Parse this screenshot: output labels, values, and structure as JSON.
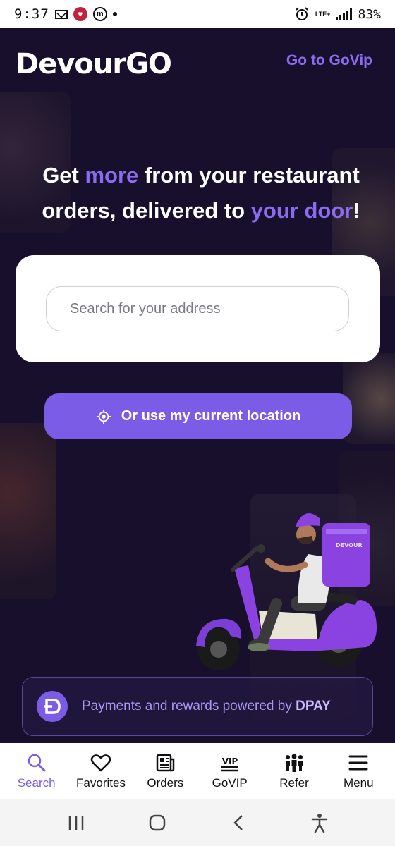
{
  "status_bar": {
    "time": "9:37",
    "battery": "83%",
    "network": "LTE+"
  },
  "header": {
    "logo_text": "DevourGO",
    "govip_link": "Go to GoVip"
  },
  "hero": {
    "headline_part1": "Get ",
    "headline_accent1": "more",
    "headline_part2": " from your restaurant orders, delivered to ",
    "headline_accent2": "your door",
    "headline_part3": "!"
  },
  "search": {
    "placeholder": "Search for your address",
    "value": ""
  },
  "location_button": {
    "label": "Or use my current location"
  },
  "promo": {
    "delivery_bag_text": "DEVOUR"
  },
  "dpay": {
    "text": "Payments and rewards powered by ",
    "brand": "DPAY"
  },
  "bottom_nav": {
    "items": [
      {
        "label": "Search",
        "icon": "search-icon",
        "active": true
      },
      {
        "label": "Favorites",
        "icon": "heart-icon",
        "active": false
      },
      {
        "label": "Orders",
        "icon": "newspaper-icon",
        "active": false
      },
      {
        "label": "GoVIP",
        "icon": "vip-icon",
        "active": false
      },
      {
        "label": "Refer",
        "icon": "people-icon",
        "active": false
      },
      {
        "label": "Menu",
        "icon": "hamburger-icon",
        "active": false
      }
    ]
  },
  "colors": {
    "accent": "#7b5ce6",
    "accent_text": "#8b6cf0",
    "background": "#170f2c",
    "white": "#ffffff"
  }
}
